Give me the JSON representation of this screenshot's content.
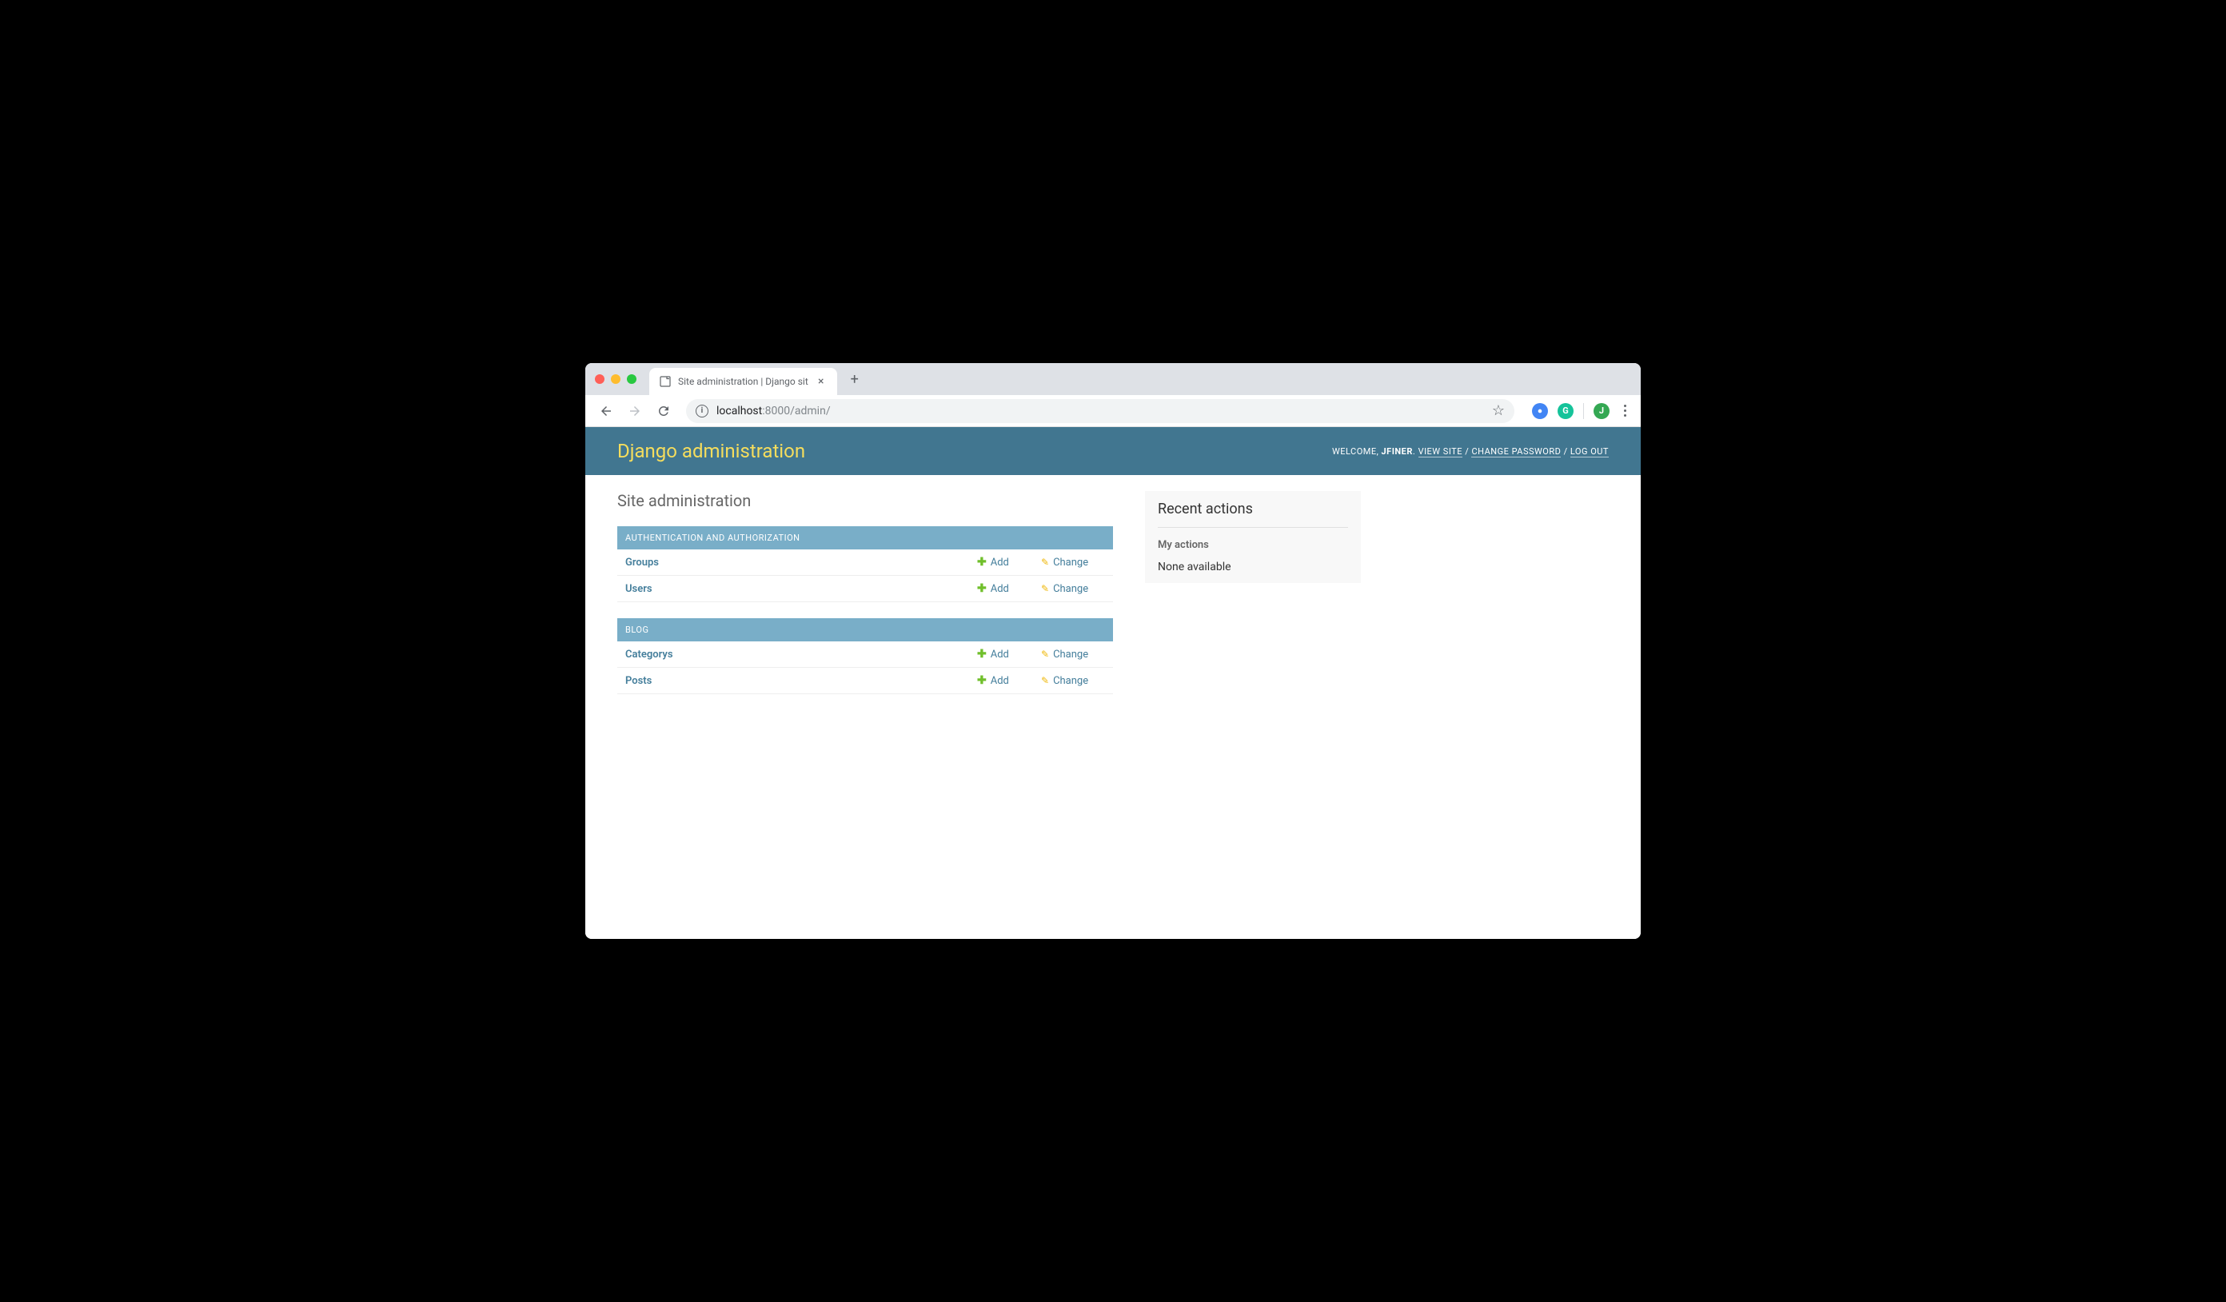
{
  "browser": {
    "tab_title": "Site administration | Django sit",
    "url_host": "localhost",
    "url_port_path": ":8000/admin/"
  },
  "header": {
    "branding": "Django administration",
    "welcome": "WELCOME, ",
    "username": "JFINER",
    "view_site": "VIEW SITE",
    "change_password": "CHANGE PASSWORD",
    "log_out": "LOG OUT"
  },
  "page": {
    "title": "Site administration"
  },
  "modules": [
    {
      "caption": "AUTHENTICATION AND AUTHORIZATION",
      "models": [
        {
          "name": "Groups",
          "add": "Add",
          "change": "Change"
        },
        {
          "name": "Users",
          "add": "Add",
          "change": "Change"
        }
      ]
    },
    {
      "caption": "BLOG",
      "models": [
        {
          "name": "Categorys",
          "add": "Add",
          "change": "Change"
        },
        {
          "name": "Posts",
          "add": "Add",
          "change": "Change"
        }
      ]
    }
  ],
  "recent": {
    "title": "Recent actions",
    "subtitle": "My actions",
    "none": "None available"
  }
}
